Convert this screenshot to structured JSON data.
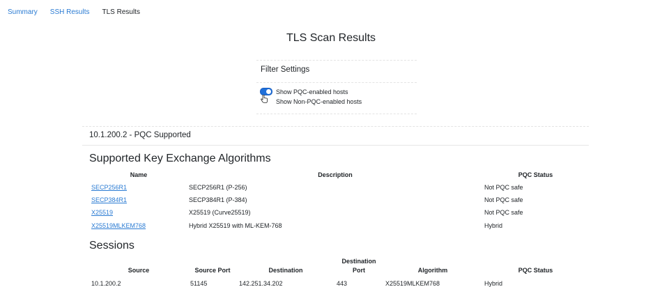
{
  "tabs": [
    {
      "label": "Summary",
      "active": false
    },
    {
      "label": "SSH Results",
      "active": false
    },
    {
      "label": "TLS Results",
      "active": true
    }
  ],
  "page_title": "TLS Scan Results",
  "filter": {
    "title": "Filter Settings",
    "options": [
      {
        "label": "Show PQC-enabled hosts",
        "enabled": true
      },
      {
        "label": "Show Non-PQC-enabled hosts"
      }
    ]
  },
  "host": {
    "title": "10.1.200.2 - PQC Supported"
  },
  "kex": {
    "title": "Supported Key Exchange Algorithms",
    "headers": [
      "Name",
      "Description",
      "PQC Status"
    ],
    "rows": [
      {
        "name": "SECP256R1",
        "description": "SECP256R1 (P-256)",
        "status": "Not PQC safe"
      },
      {
        "name": "SECP384R1",
        "description": "SECP384R1 (P-384)",
        "status": "Not PQC safe"
      },
      {
        "name": "X25519",
        "description": "X25519 (Curve25519)",
        "status": "Not PQC safe"
      },
      {
        "name": "X25519MLKEM768",
        "description": "Hybrid X25519 with ML-KEM-768",
        "status": "Hybrid"
      }
    ]
  },
  "sessions": {
    "title": "Sessions",
    "headers": {
      "source": "Source",
      "source_port": "Source Port",
      "destination": "Destination",
      "destination_port_line1": "Destination",
      "destination_port_line2": "Port",
      "algorithm": "Algorithm",
      "pqc_status": "PQC Status"
    },
    "rows": [
      {
        "source": "10.1.200.2",
        "source_port": "51145",
        "destination": "142.251.34.202",
        "destination_port": "443",
        "algorithm": "X25519MLKEM768",
        "pqc_status": "Hybrid"
      }
    ]
  },
  "colors": {
    "link": "#2a7bd3",
    "toggle": "#1f6fd9"
  }
}
